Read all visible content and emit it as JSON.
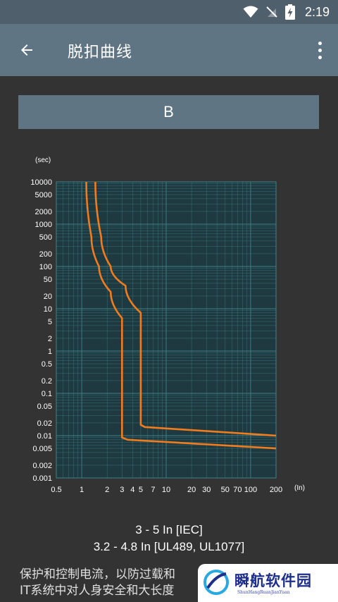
{
  "status_bar": {
    "time": "2:19",
    "icons": [
      "wifi-icon",
      "no-sim-icon",
      "battery-charging-icon"
    ]
  },
  "app_bar": {
    "title": "脱扣曲线",
    "back_icon": "arrow-back-icon",
    "menu_icon": "more-vert-icon"
  },
  "curve_selector": {
    "label": "B"
  },
  "chart_data": {
    "type": "line",
    "xscale": "log",
    "yscale": "log",
    "y_unit": "(sec)",
    "x_unit": "(In)",
    "xlim": [
      0.5,
      200
    ],
    "ylim": [
      0.001,
      10000
    ],
    "x_ticks": [
      "0.5",
      "1",
      "2",
      "3",
      "4",
      "5",
      "7",
      "10",
      "20",
      "30",
      "50",
      "70",
      "100",
      "200"
    ],
    "y_ticks": [
      "10000",
      "5000",
      "2000",
      "1000",
      "500",
      "200",
      "100",
      "50",
      "20",
      "10",
      "5",
      "2",
      "1",
      "0.5",
      "0.2",
      "0.1",
      "0.05",
      "0.02",
      "0.01",
      "0.005",
      "0.002",
      "0.001"
    ],
    "grid": true,
    "series": [
      {
        "color": "#f07c1e",
        "points": [
          [
            1.13,
            10000
          ],
          [
            1.3,
            500
          ],
          [
            1.6,
            100
          ],
          [
            2.2,
            25
          ],
          [
            3.0,
            6
          ],
          [
            3.0,
            0.009
          ],
          [
            3.5,
            0.008
          ],
          [
            200,
            0.005
          ]
        ]
      },
      {
        "color": "#f07c1e",
        "points": [
          [
            1.45,
            10000
          ],
          [
            1.7,
            500
          ],
          [
            2.2,
            100
          ],
          [
            3.3,
            35
          ],
          [
            5.0,
            8
          ],
          [
            5.0,
            0.018
          ],
          [
            5.6,
            0.016
          ],
          [
            200,
            0.01
          ]
        ]
      }
    ]
  },
  "range_iec": "3 - 5 In  [IEC]",
  "range_ul": "3.2 - 4.8 In  [UL489, UL1077]",
  "description": {
    "line1": "保护和控制电流，以防过载和",
    "line2": "IT系统中对人身安全和大长度"
  },
  "watermark": {
    "text": "瞬航软件园",
    "sub": "ShunHangRuanJianYuan"
  },
  "colors": {
    "status_bar": "#4f5f6c",
    "app_bar": "#607584",
    "background": "#333333",
    "chart_bg": "#1e3a40",
    "grid": "#3f8088",
    "curve": "#f07c1e"
  }
}
